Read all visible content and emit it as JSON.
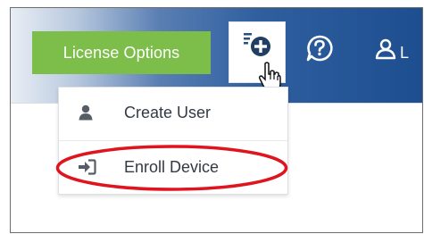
{
  "header": {
    "license_button": "License Options",
    "add_button_icon": "add-icon",
    "help_icon": "help-icon",
    "user_icon": "user-icon",
    "user_label_partial": "L"
  },
  "dropdown": {
    "items": [
      {
        "label": "Create User",
        "icon": "user-icon"
      },
      {
        "label": "Enroll Device",
        "icon": "sign-in-icon"
      }
    ]
  },
  "colors": {
    "license_green": "#7dbd4a",
    "topbar_blue": "#1d4e8f",
    "highlight_red": "#e0141e"
  }
}
